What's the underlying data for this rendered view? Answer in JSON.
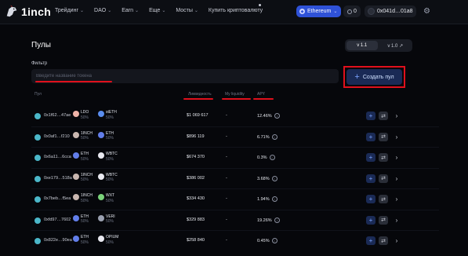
{
  "header": {
    "logo_text": "1inch",
    "nav": [
      {
        "label": "Трейдинг",
        "has_menu": true
      },
      {
        "label": "DAO",
        "has_menu": true
      },
      {
        "label": "Earn",
        "has_menu": true
      },
      {
        "label": "Еще",
        "has_menu": true
      },
      {
        "label": "Мосты",
        "has_menu": true
      },
      {
        "label": "Купить криптовалюту",
        "has_menu": false
      }
    ],
    "network_label": "Ethereum",
    "notifications_count": "0",
    "account_address": "0x041d…01a8",
    "settings_icon": "gear-icon"
  },
  "page": {
    "title": "Пулы",
    "versions": [
      "v 1.1",
      "v 1.0 ↗"
    ],
    "active_version": "v 1.1",
    "filter_label": "Фильтр",
    "filter_placeholder": "Введите название токена",
    "create_button_label": "Создать пул",
    "highlight_color": "#e0101c"
  },
  "table": {
    "headers": {
      "pool": "Пул",
      "liquidity": "Ликвидность",
      "my_liquidity": "My liquidity",
      "apy": "APY"
    },
    "rows": [
      {
        "address": "0x1f62…47ae",
        "token_a": "LDO",
        "pct_a": "50%",
        "token_b": "stETH",
        "pct_b": "50%",
        "liquidity": "$1 069 617",
        "my_liquidity": "-",
        "apy": "12.46%",
        "color_a": "#f0b3a8",
        "color_b": "#5a8dee"
      },
      {
        "address": "0x0af1…f210",
        "token_a": "1INCH",
        "pct_a": "50%",
        "token_b": "ETH",
        "pct_b": "50%",
        "liquidity": "$896 119",
        "my_liquidity": "-",
        "apy": "6.71%",
        "color_a": "#c9b7b0",
        "color_b": "#627eea"
      },
      {
        "address": "0x6a11…6cca",
        "token_a": "ETH",
        "pct_a": "50%",
        "token_b": "WBTC",
        "pct_b": "50%",
        "liquidity": "$674 370",
        "my_liquidity": "-",
        "apy": "0.3%",
        "color_a": "#627eea",
        "color_b": "#e9e9f0"
      },
      {
        "address": "0xe179…518a",
        "token_a": "1INCH",
        "pct_a": "50%",
        "token_b": "WBTC",
        "pct_b": "50%",
        "liquidity": "$386 002",
        "my_liquidity": "-",
        "apy": "3.68%",
        "color_a": "#c9b7b0",
        "color_b": "#e9e9f0"
      },
      {
        "address": "0x7beb…f5ea",
        "token_a": "1INCH",
        "pct_a": "50%",
        "token_b": "WXT",
        "pct_b": "50%",
        "liquidity": "$334 430",
        "my_liquidity": "-",
        "apy": "1.94%",
        "color_a": "#c9b7b0",
        "color_b": "#7ad37a"
      },
      {
        "address": "0xfd97…7602",
        "token_a": "ETH",
        "pct_a": "50%",
        "token_b": "VERI",
        "pct_b": "50%",
        "liquidity": "$329 883",
        "my_liquidity": "-",
        "apy": "19.26%",
        "color_a": "#627eea",
        "color_b": "#9aa0b0"
      },
      {
        "address": "0x822e…90ea",
        "token_a": "ETH",
        "pct_a": "50%",
        "token_b": "OPIUM",
        "pct_b": "50%",
        "liquidity": "$258 840",
        "my_liquidity": "-",
        "apy": "0.45%",
        "color_a": "#627eea",
        "color_b": "#e9e9f0"
      }
    ]
  }
}
